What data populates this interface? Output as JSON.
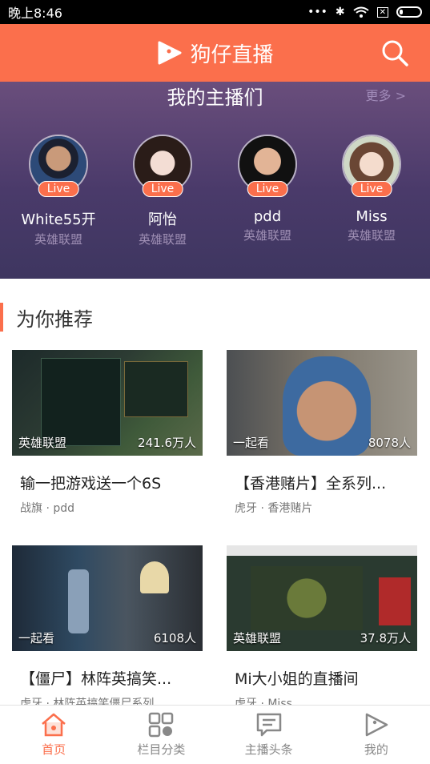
{
  "status_bar": {
    "time": "晚上8:46"
  },
  "header": {
    "title": "狗仔直播",
    "search_icon": "search-icon"
  },
  "banner": {
    "title": "我的主播们",
    "more": "更多 >",
    "anchors": [
      {
        "name": "White55开",
        "game": "英雄联盟",
        "badge": "Live"
      },
      {
        "name": "阿怡",
        "game": "英雄联盟",
        "badge": "Live"
      },
      {
        "name": "pdd",
        "game": "英雄联盟",
        "badge": "Live"
      },
      {
        "name": "Miss",
        "game": "英雄联盟",
        "badge": "Live"
      }
    ]
  },
  "recommend": {
    "title": "为你推荐",
    "cards": [
      {
        "tag": "英雄联盟",
        "viewers": "241.6万人",
        "title": "输一把游戏送一个6S",
        "sub": "战旗 · pdd"
      },
      {
        "tag": "一起看",
        "viewers": "8078人",
        "title": "【香港赌片】全系列...",
        "sub": "虎牙 · 香港赌片"
      },
      {
        "tag": "一起看",
        "viewers": "6108人",
        "title": "【僵尸】林阵英搞笑...",
        "sub": "虎牙 · 林阵英搞笑僵尸系列"
      },
      {
        "tag": "英雄联盟",
        "viewers": "37.8万人",
        "title": "Mi大小姐的直播间",
        "sub": "虎牙 · Miss"
      }
    ]
  },
  "tabbar": {
    "tabs": [
      {
        "label": "首页",
        "icon": "home-icon",
        "active": true
      },
      {
        "label": "栏目分类",
        "icon": "grid-icon",
        "active": false
      },
      {
        "label": "主播头条",
        "icon": "message-icon",
        "active": false
      },
      {
        "label": "我的",
        "icon": "profile-icon",
        "active": false
      }
    ]
  },
  "colors": {
    "accent": "#fb6f4c",
    "banner": "#4a3a6a"
  }
}
